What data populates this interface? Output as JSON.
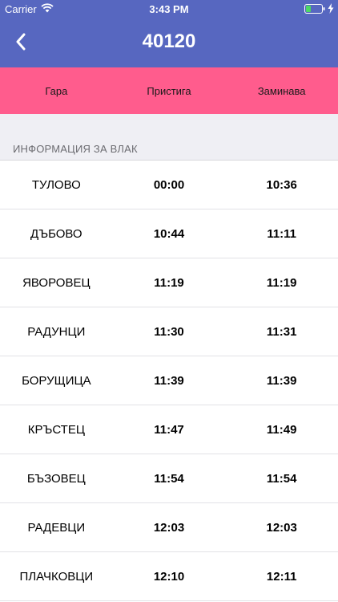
{
  "status_bar": {
    "carrier": "Carrier",
    "time": "3:43 PM",
    "wifi_icon": "wifi-icon",
    "battery_icon": "battery-icon",
    "charging_icon": "bolt-icon"
  },
  "nav": {
    "back_icon": "chevron-left-icon",
    "title": "40120"
  },
  "columns": {
    "station": "Гара",
    "arrives": "Пристига",
    "departs": "Заминава"
  },
  "section": {
    "title": "ИНФОРМАЦИЯ ЗА ВЛАК"
  },
  "stops": [
    {
      "station": "ТУЛОВО",
      "arrive": "00:00",
      "depart": "10:36"
    },
    {
      "station": "ДЪБОВО",
      "arrive": "10:44",
      "depart": "11:11"
    },
    {
      "station": "ЯВОРОВЕЦ",
      "arrive": "11:19",
      "depart": "11:19"
    },
    {
      "station": "РАДУНЦИ",
      "arrive": "11:30",
      "depart": "11:31"
    },
    {
      "station": "БОРУЩИЦА",
      "arrive": "11:39",
      "depart": "11:39"
    },
    {
      "station": "КРЪСТЕЦ",
      "arrive": "11:47",
      "depart": "11:49"
    },
    {
      "station": "БЪЗОВЕЦ",
      "arrive": "11:54",
      "depart": "11:54"
    },
    {
      "station": "РАДЕВЦИ",
      "arrive": "12:03",
      "depart": "12:03"
    },
    {
      "station": "ПЛАЧКОВЦИ",
      "arrive": "12:10",
      "depart": "12:11"
    }
  ],
  "colors": {
    "header": "#5767c0",
    "columns_bar": "#ff5c8d",
    "section_bg": "#efeff4"
  }
}
